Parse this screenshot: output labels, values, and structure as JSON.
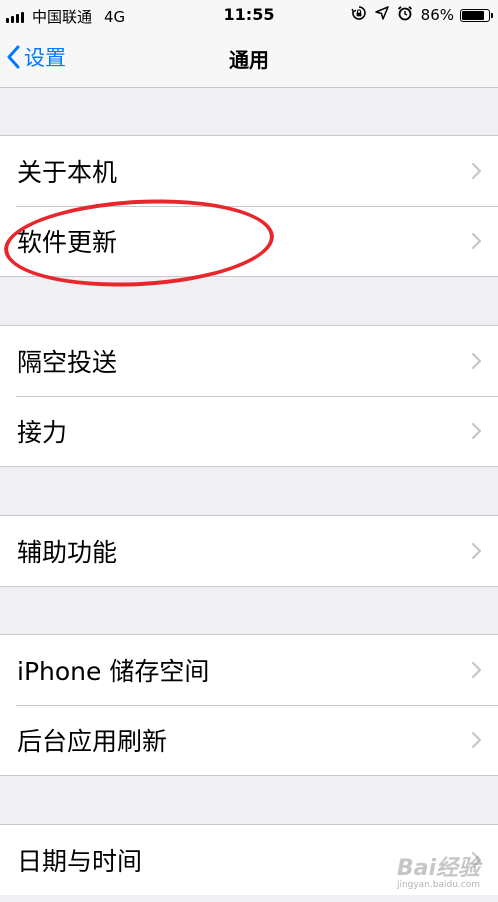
{
  "status_bar": {
    "carrier": "中国联通",
    "network": "4G",
    "time": "11:55",
    "battery": "86%",
    "battery_level": 0.86,
    "icons": [
      "lock-rotation-icon",
      "location-icon",
      "alarm-icon"
    ]
  },
  "nav": {
    "back_label": "设置",
    "title": "通用"
  },
  "groups": [
    {
      "items": [
        "关于本机",
        "软件更新"
      ]
    },
    {
      "items": [
        "隔空投送",
        "接力"
      ]
    },
    {
      "items": [
        "辅助功能"
      ]
    },
    {
      "items": [
        "iPhone 储存空间",
        "后台应用刷新"
      ]
    },
    {
      "items": [
        "日期与时间"
      ]
    }
  ],
  "annotation": {
    "color": "#e8262b",
    "target": "软件更新"
  },
  "watermark": {
    "logo": "Bai经验",
    "sub": "jingyan.baidu.com"
  },
  "colors": {
    "accent": "#007aff",
    "background": "#efeff4",
    "separator": "#c8c7cc"
  }
}
